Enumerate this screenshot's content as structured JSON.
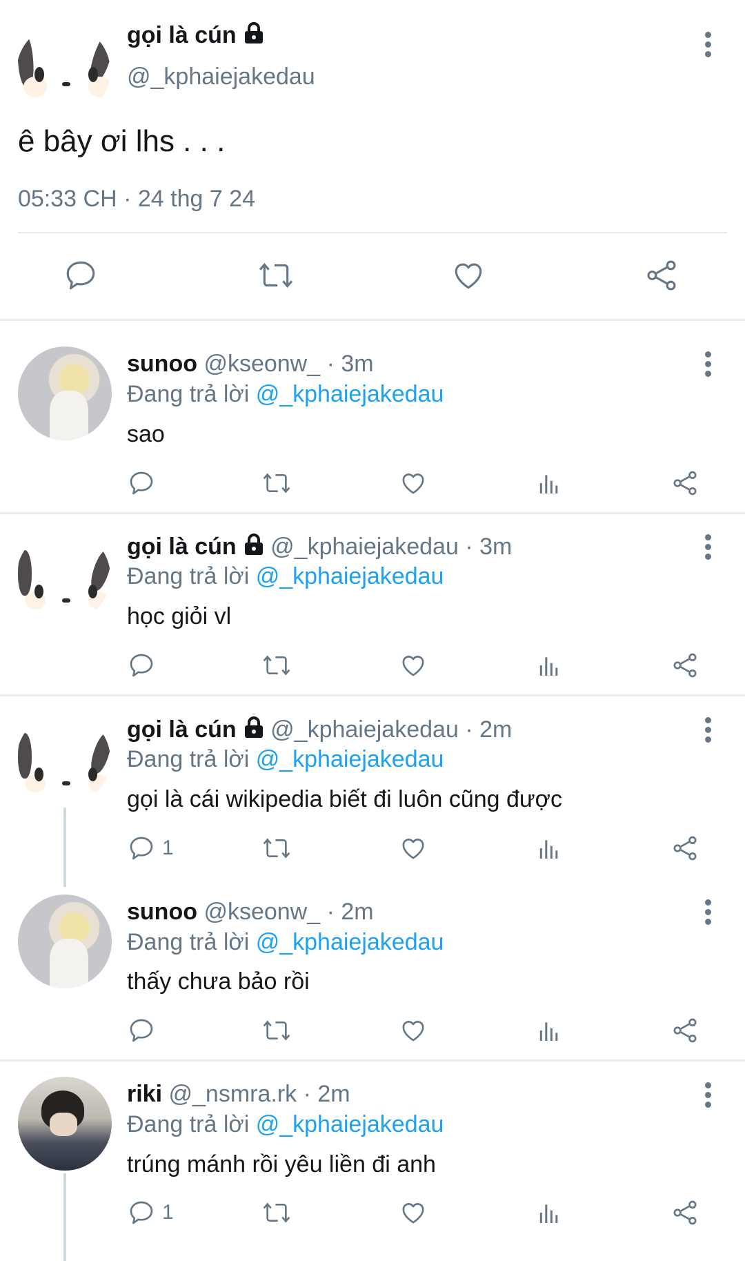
{
  "main_tweet": {
    "display_name": "gọi là cún",
    "handle": "@_kphaiejakedau",
    "text": "ê bây ơi lhs . . .",
    "timestamp": "05:33 CH · 24 thg 7 24"
  },
  "replying_label": "Đang trả lời",
  "replies": [
    {
      "name": "sunoo",
      "handle": "@kseonw_",
      "time": "· 3m",
      "reply_to": "@_kphaiejakedau",
      "text": "sao",
      "reply_count": ""
    },
    {
      "name": "gọi là cún",
      "handle": "@_kphaiejakedau",
      "time": "· 3m",
      "reply_to": "@_kphaiejakedau",
      "text": "học giỏi vl",
      "reply_count": ""
    },
    {
      "name": "gọi là cún",
      "handle": "@_kphaiejakedau",
      "time": "· 2m",
      "reply_to": "@_kphaiejakedau",
      "text": "gọi là cái wikipedia biết đi luôn cũng được",
      "reply_count": "1"
    },
    {
      "name": "sunoo",
      "handle": "@kseonw_",
      "time": "· 2m",
      "reply_to": "@_kphaiejakedau",
      "text": "thấy chưa bảo rồi",
      "reply_count": ""
    },
    {
      "name": "riki",
      "handle": "@_nsmra.rk",
      "time": "· 2m",
      "reply_to": "@_kphaiejakedau",
      "text": "trúng mánh rồi yêu liền đi anh",
      "reply_count": "1"
    }
  ],
  "icons": [
    "reply-icon",
    "retweet-icon",
    "like-icon",
    "analytics-icon",
    "share-icon",
    "more-icon",
    "lock-icon"
  ],
  "colors": {
    "link": "#1da1f2",
    "muted": "#657786"
  }
}
